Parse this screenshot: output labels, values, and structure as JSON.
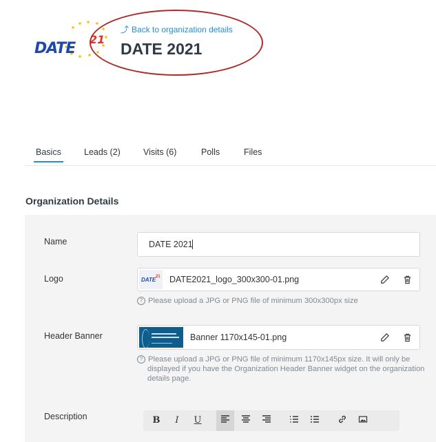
{
  "header": {
    "logo_text": "DATE",
    "logo_superscript": "21",
    "back_link": "Back to organization details",
    "org_title": "DATE 2021"
  },
  "tabs": [
    {
      "label": "Basics",
      "active": true
    },
    {
      "label": "Leads (2)",
      "active": false
    },
    {
      "label": "Visits (6)",
      "active": false
    },
    {
      "label": "Polls",
      "active": false
    },
    {
      "label": "Files",
      "active": false
    }
  ],
  "section_title": "Organization Details",
  "form": {
    "name_label": "Name",
    "name_value": "DATE 2021",
    "logo_label": "Logo",
    "logo_file": "DATE2021_logo_300x300-01.png",
    "logo_hint": "Please upload a JPG or PNG file of minimum 300x300px size",
    "banner_label": "Header Banner",
    "banner_file": "Banner 1170x145-01.png",
    "banner_hint": "Please upload a JPG or PNG file of minimum 1170x145px size. It will only be displayed if you have the Organization Header Banner widget on the organization details page.",
    "description_label": "Description"
  },
  "toolbar": {
    "bold": "B",
    "italic": "I",
    "underline": "U"
  },
  "colors": {
    "accent": "#1f8ed6",
    "annotation": "#b02a2a",
    "panel": "#f4f4f4"
  }
}
